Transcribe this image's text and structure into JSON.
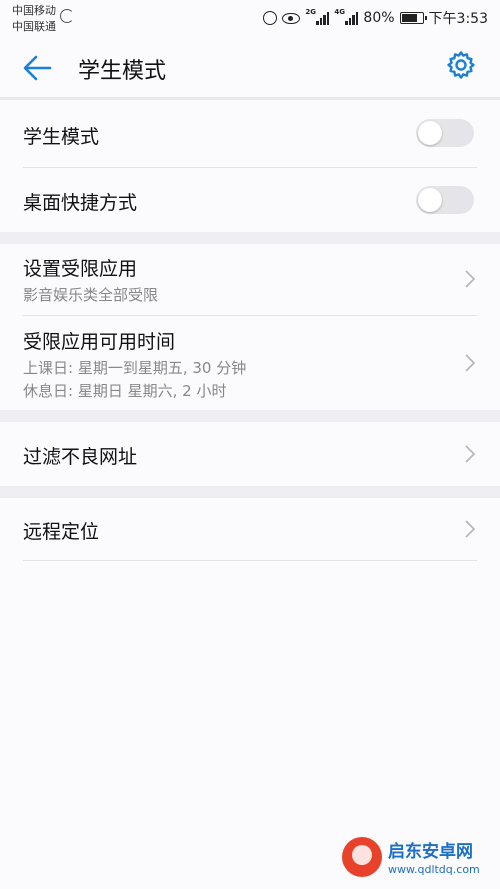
{
  "status_bar": {
    "carrier_1": "中国移动",
    "carrier_2": "中国联通",
    "signal_1_label": "2G",
    "signal_2_label": "4G",
    "battery": "80%",
    "time": "下午3:53"
  },
  "header": {
    "title": "学生模式",
    "accent_color": "#1a7fd6"
  },
  "settings": {
    "student_mode": {
      "label": "学生模式",
      "enabled": false
    },
    "desktop_shortcut": {
      "label": "桌面快捷方式",
      "enabled": false
    },
    "restricted_apps": {
      "label": "设置受限应用",
      "sub": "影音娱乐类全部受限"
    },
    "app_time": {
      "label": "受限应用可用时间",
      "sub_school": "上课日: 星期一到星期五, 30 分钟",
      "sub_rest": "休息日: 星期日 星期六, 2 小时"
    },
    "url_filter": {
      "label": "过滤不良网址"
    },
    "remote_locate": {
      "label": "远程定位"
    }
  },
  "watermark": {
    "name": "启东安卓网",
    "url": "www.qdltdq.com"
  }
}
